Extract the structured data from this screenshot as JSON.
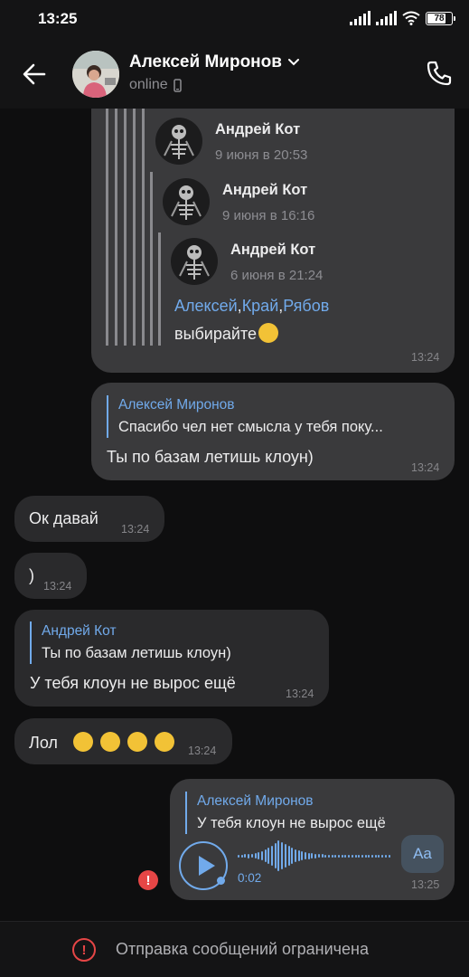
{
  "status_bar": {
    "time": "13:25",
    "battery": "78",
    "battery_level": 0.78,
    "icons": [
      "signal-icon",
      "signal-icon",
      "wifi-icon",
      "battery-icon"
    ]
  },
  "header": {
    "name": "Алексей Миронов",
    "status": "online",
    "icons": [
      "back-arrow-icon",
      "chevron-down-icon",
      "phone-device-icon",
      "phone-call-icon"
    ]
  },
  "forwarded": {
    "items": [
      {
        "author": "Андрей Кот",
        "date": "9 июня в 20:53"
      },
      {
        "author": "Андрей Кот",
        "date": "9 июня в 16:16"
      },
      {
        "author": "Андрей Кот",
        "date": "6 июня в 21:24"
      }
    ],
    "mentions": [
      "Алексей",
      "Край",
      "Рябов"
    ],
    "text": "выбирайте",
    "time": "13:24"
  },
  "messages": [
    {
      "direction": "out",
      "reply_author": "Алексей Миронов",
      "reply_text": "Спасибо чел нет смысла у тебя поку...",
      "text": "Ты по базам летишь клоун)",
      "time": "13:24"
    },
    {
      "direction": "in",
      "text": "Ок давай",
      "time": "13:24"
    },
    {
      "direction": "in",
      "text": ")",
      "time": "13:24"
    },
    {
      "direction": "in",
      "reply_author": "Андрей Кот",
      "reply_text": "Ты по базам летишь клоун)",
      "text": "У тебя клоун не вырос ещё",
      "time": "13:24"
    },
    {
      "direction": "in",
      "text": "Лол",
      "emoji_count": 4,
      "time": "13:24"
    }
  ],
  "voice": {
    "reply_author": "Алексей Миронов",
    "reply_text": "У тебя клоун не вырос ещё",
    "duration": "0:02",
    "transcribe_label": "Aa",
    "time": "13:25",
    "failed": true
  },
  "composer": {
    "notice": "Отправка сообщений ограничена"
  },
  "colors": {
    "background": "#0e0e0f",
    "bubble_out": "#3a3a3c",
    "bubble_in": "#2a2a2c",
    "accent": "#71aaeb",
    "error": "#e64646"
  }
}
